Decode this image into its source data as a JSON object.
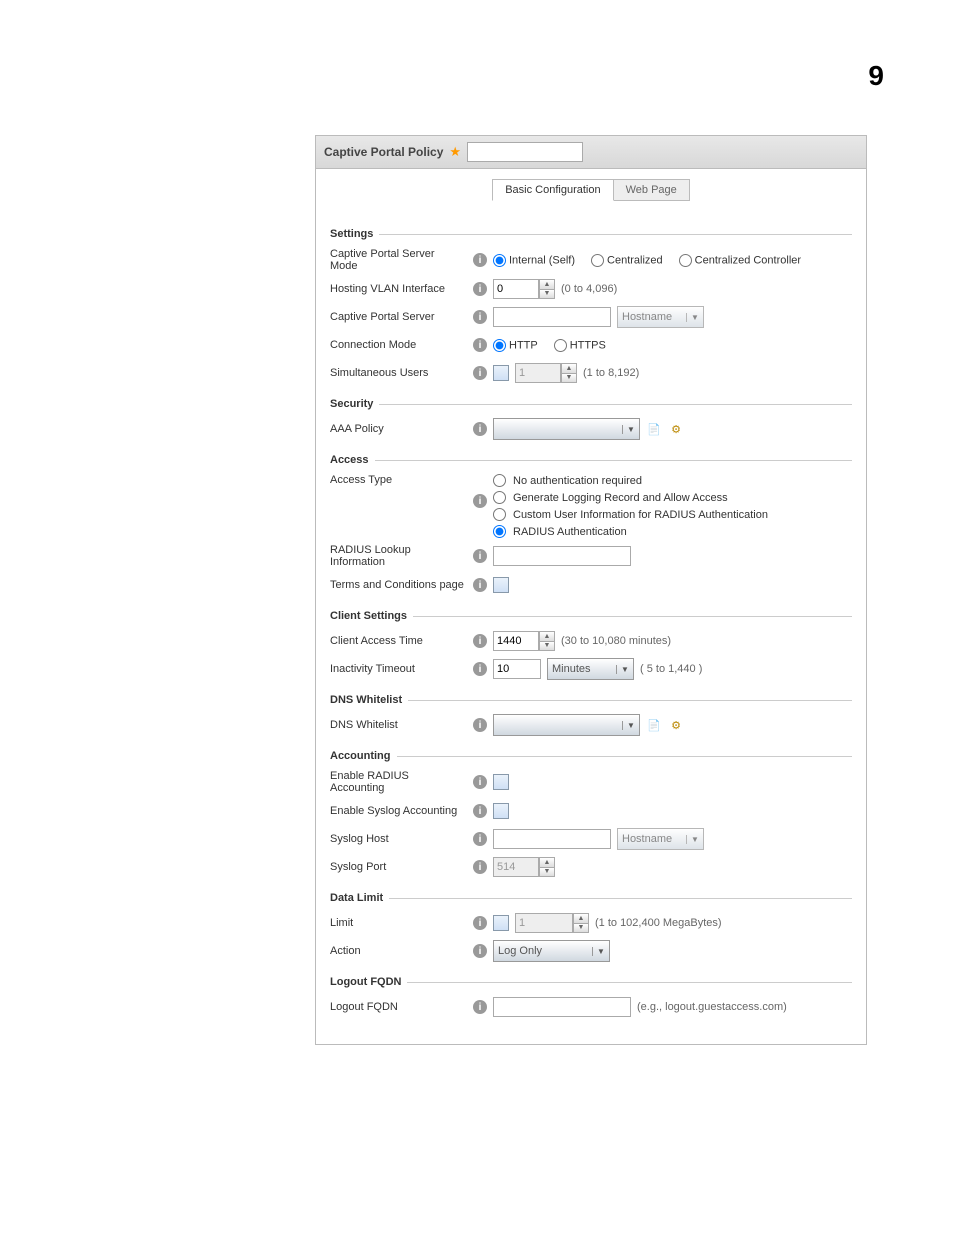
{
  "page_number": "9",
  "header": {
    "title": "Captive Portal Policy"
  },
  "tabs": {
    "basic": "Basic Configuration",
    "web": "Web Page"
  },
  "sections": {
    "settings": "Settings",
    "security": "Security",
    "access": "Access",
    "client": "Client Settings",
    "dns": "DNS Whitelist",
    "accounting": "Accounting",
    "datalimit": "Data Limit",
    "logout": "Logout FQDN"
  },
  "settings": {
    "server_mode_label": "Captive Portal Server Mode",
    "server_mode_opts": {
      "internal": "Internal (Self)",
      "centralized": "Centralized",
      "centralized_ctrl": "Centralized Controller"
    },
    "vlan_label": "Hosting VLAN Interface",
    "vlan_value": "0",
    "vlan_hint": "(0 to 4,096)",
    "server_label": "Captive Portal Server",
    "server_type": "Hostname",
    "conn_mode_label": "Connection Mode",
    "conn_opts": {
      "http": "HTTP",
      "https": "HTTPS"
    },
    "sim_users_label": "Simultaneous Users",
    "sim_users_value": "1",
    "sim_users_hint": "(1 to 8,192)"
  },
  "security": {
    "aaa_label": "AAA Policy"
  },
  "access": {
    "type_label": "Access Type",
    "opts": {
      "none": "No authentication required",
      "log": "Generate Logging Record and Allow Access",
      "custom": "Custom User Information for RADIUS Authentication",
      "radius": "RADIUS Authentication"
    },
    "radius_lookup_label": "RADIUS Lookup Information",
    "terms_label": "Terms and Conditions page"
  },
  "client": {
    "access_time_label": "Client Access Time",
    "access_time_value": "1440",
    "access_time_hint": "(30 to 10,080 minutes)",
    "inactivity_label": "Inactivity Timeout",
    "inactivity_value": "10",
    "inactivity_unit": "Minutes",
    "inactivity_hint": "( 5 to 1,440 )"
  },
  "dns": {
    "label": "DNS Whitelist"
  },
  "accounting": {
    "radius_label": "Enable RADIUS Accounting",
    "syslog_label": "Enable Syslog Accounting",
    "syslog_host_label": "Syslog Host",
    "syslog_host_type": "Hostname",
    "syslog_port_label": "Syslog Port",
    "syslog_port_value": "514"
  },
  "datalimit": {
    "limit_label": "Limit",
    "limit_value": "1",
    "limit_hint": "(1 to 102,400 MegaBytes)",
    "action_label": "Action",
    "action_value": "Log Only"
  },
  "logout": {
    "label": "Logout FQDN",
    "hint": "(e.g., logout.guestaccess.com)"
  }
}
